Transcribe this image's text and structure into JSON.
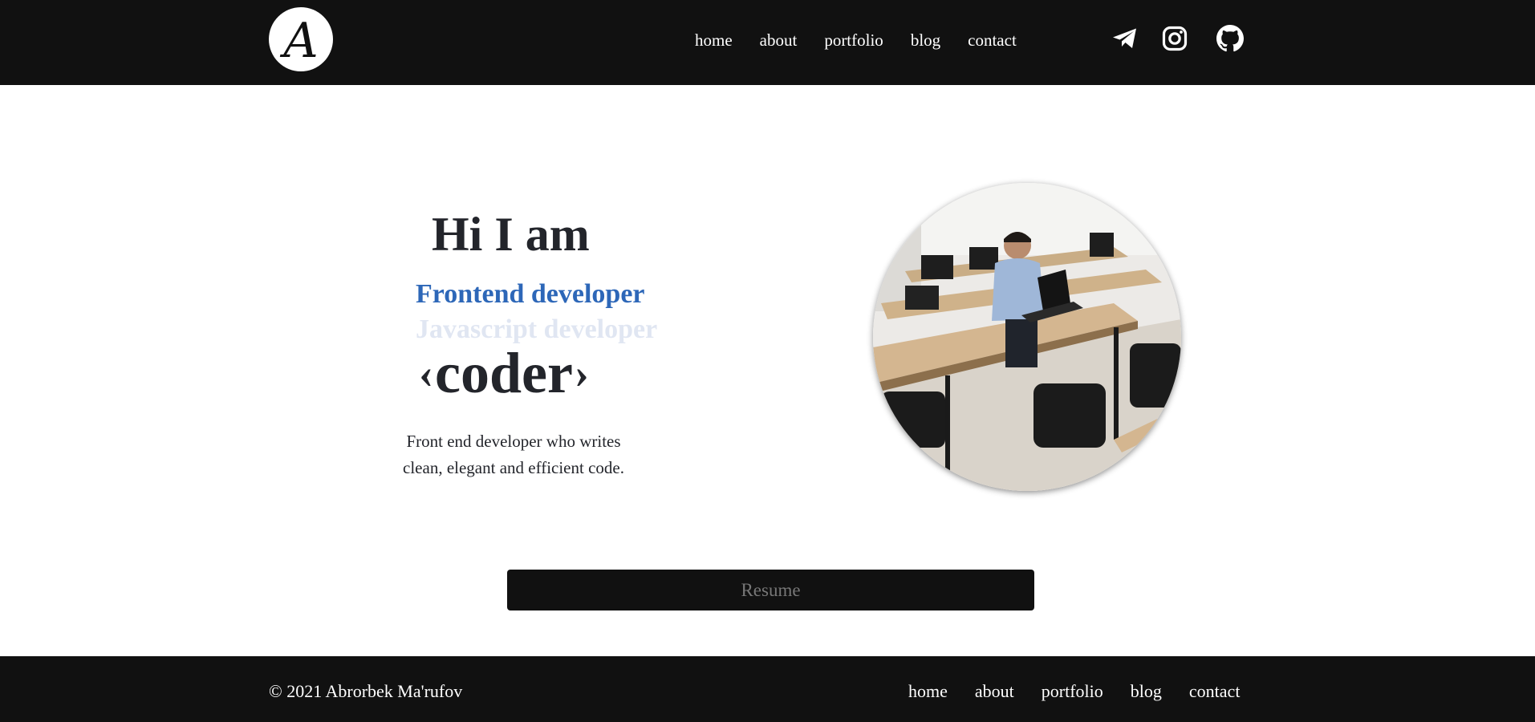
{
  "header": {
    "logo_letter": "A",
    "nav": [
      "home",
      "about",
      "portfolio",
      "blog",
      "contact"
    ],
    "socials": [
      "telegram-icon",
      "instagram-icon",
      "github-icon"
    ]
  },
  "hero": {
    "greeting": "Hi I am",
    "role_active": "Frontend developer",
    "role_next": "Javascript developer",
    "bracket_open": "‹",
    "title": "coder",
    "bracket_close": "›",
    "description_line1": "Front end developer who writes",
    "description_line2": "clean, elegant and efficient code."
  },
  "resume_label": "Resume",
  "footer": {
    "copyright": "© 2021 Abrorbek Ma'rufov",
    "nav": [
      "home",
      "about",
      "portfolio",
      "blog",
      "contact"
    ]
  },
  "colors": {
    "bar": "#111111",
    "accent": "#2d67b8",
    "text": "#23252b"
  }
}
